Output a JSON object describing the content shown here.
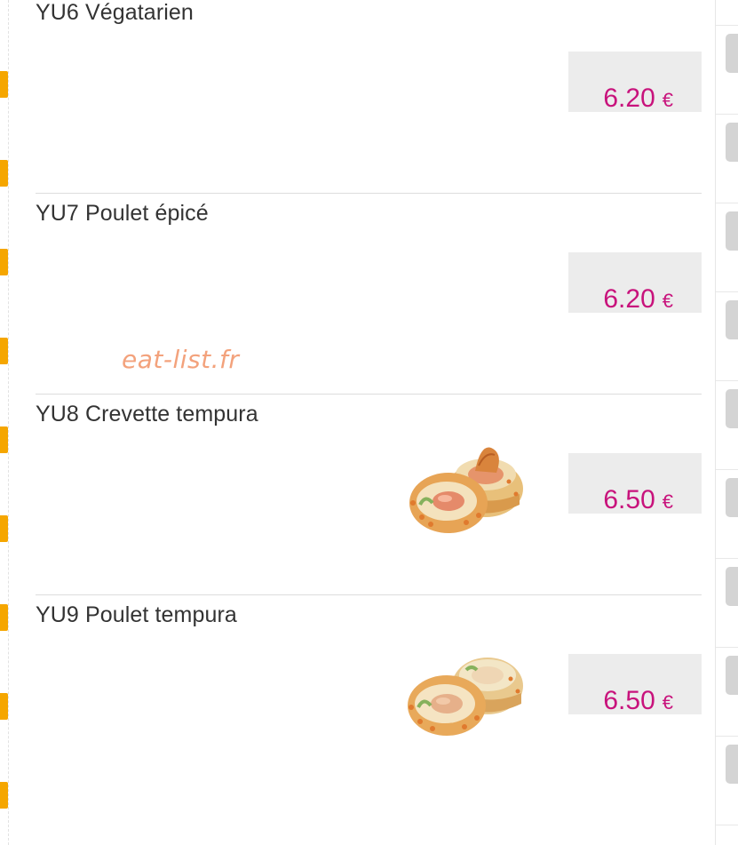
{
  "menu": {
    "items": [
      {
        "name": "YU6 Végatarien",
        "price": "6.20",
        "currency": "€",
        "has_photo": false
      },
      {
        "name": "YU7 Poulet épicé",
        "price": "6.20",
        "currency": "€",
        "has_photo": false
      },
      {
        "name": "YU8 Crevette tempura",
        "price": "6.50",
        "currency": "€",
        "has_photo": true
      },
      {
        "name": "YU9 Poulet tempura",
        "price": "6.50",
        "currency": "€",
        "has_photo": true
      }
    ]
  },
  "watermark": "eat-list.fr",
  "colors": {
    "price": "#c8137c",
    "accent_tab": "#f5a600",
    "price_bg": "#ececec",
    "watermark": "#f3a27c"
  }
}
